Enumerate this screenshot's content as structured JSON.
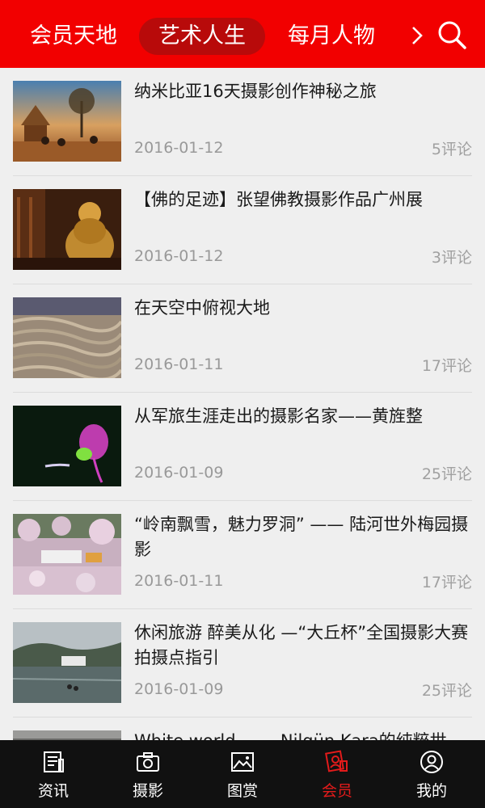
{
  "header": {
    "tabs": [
      {
        "label": "会员天地",
        "active": false
      },
      {
        "label": "艺术人生",
        "active": true
      },
      {
        "label": "每月人物",
        "active": false
      }
    ],
    "more_icon": "chevron-right-icon",
    "search_icon": "search-icon",
    "accent_color": "#f20000"
  },
  "articles": [
    {
      "title": "纳米比亚16天摄影创作神秘之旅",
      "date": "2016-01-12",
      "comments": "5评论"
    },
    {
      "title": "【佛的足迹】张望佛教摄影作品广州展",
      "date": "2016-01-12",
      "comments": "3评论"
    },
    {
      "title": " 在天空中俯视大地",
      "date": "2016-01-11",
      "comments": "17评论"
    },
    {
      "title": "从军旅生涯走出的摄影名家——黄旌整",
      "date": "2016-01-09",
      "comments": "25评论"
    },
    {
      "title": "“岭南飘雪，魅力罗洞” —— 陆河世外梅园摄影",
      "date": "2016-01-11",
      "comments": "17评论"
    },
    {
      "title": "休闲旅游 醉美从化 —“大丘杯”全国摄影大赛拍摄点指引",
      "date": "2016-01-09",
      "comments": "25评论"
    },
    {
      "title": "White world —— Nilgün Kara的纯粹世",
      "date": "",
      "comments": ""
    }
  ],
  "bottom_nav": [
    {
      "label": "资讯",
      "icon": "news-icon",
      "active": false
    },
    {
      "label": "摄影",
      "icon": "camera-icon",
      "active": false
    },
    {
      "label": "图赏",
      "icon": "gallery-icon",
      "active": false
    },
    {
      "label": "会员",
      "icon": "member-icon",
      "active": true
    },
    {
      "label": "我的",
      "icon": "profile-icon",
      "active": false
    }
  ]
}
